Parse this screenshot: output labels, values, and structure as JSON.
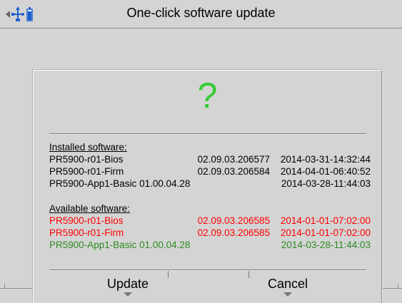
{
  "window": {
    "title": "One-click software update",
    "status_icons": [
      "back-arrow-icon",
      "usb-icon",
      "battery-icon"
    ]
  },
  "dialog": {
    "icon": "question-mark-icon",
    "icon_glyph": "?",
    "icon_color": "#33cc33",
    "installed": {
      "title": "Installed software:",
      "rows": [
        {
          "name": "PR5900-r01-Bios",
          "version": "02.09.03.206577",
          "date": "2014-03-31-14:32:44"
        },
        {
          "name": "PR5900-r01-Firm",
          "version": "02.09.03.206584",
          "date": "2014-04-01-06:40:52"
        },
        {
          "name": "PR5900-App1-Basic 01.00.04.28",
          "version": "",
          "date": "2014-03-28-11:44:03"
        }
      ]
    },
    "available": {
      "title": "Available software:",
      "rows": [
        {
          "name": "PR5900-r01-Bios",
          "version": "02.09.03.206585",
          "date": "2014-01-01-07:02:00",
          "color": "#ff0000"
        },
        {
          "name": "PR5900-r01-Firm",
          "version": "02.09.03.206585",
          "date": "2014-01-01-07:02:00",
          "color": "#ff0000"
        },
        {
          "name": "PR5900-App1-Basic 01.00.04.28",
          "version": "",
          "date": "2014-03-28-11:44:03",
          "color": "#2e8b22"
        }
      ]
    },
    "buttons": {
      "update_label": "Update",
      "cancel_label": "Cancel"
    }
  }
}
